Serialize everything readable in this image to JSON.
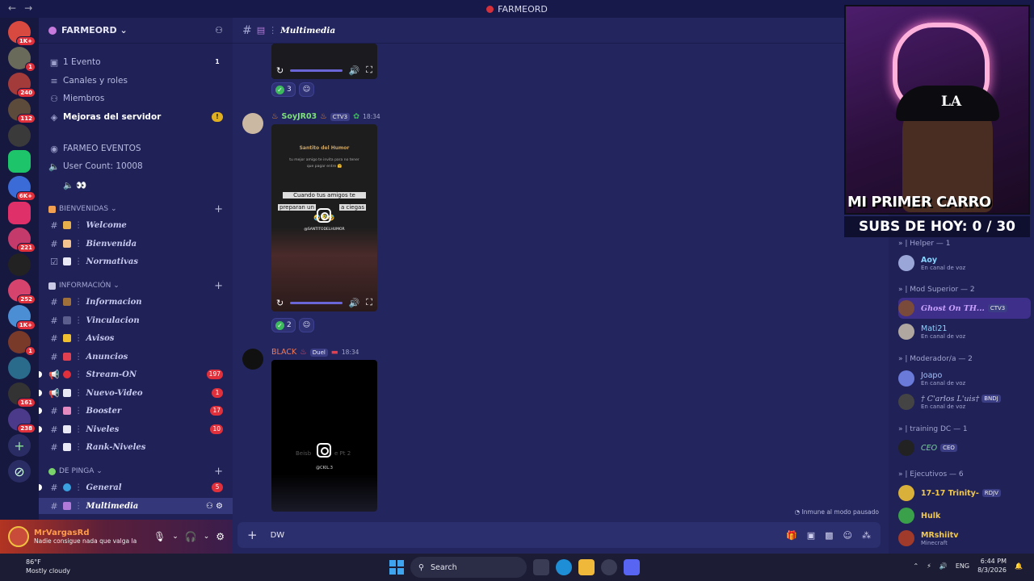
{
  "window": {
    "title": "FARMEORD",
    "back": "←",
    "forward": "→"
  },
  "guilds": {
    "badges": [
      "1K+",
      "1",
      "240",
      "112",
      "6K+",
      "221",
      "252",
      "1K+",
      "1",
      "161",
      "238"
    ]
  },
  "server": {
    "name": "FARMEORD ⌄",
    "items": [
      {
        "label": "1 Evento",
        "count": "1"
      },
      {
        "label": "Canales y roles"
      },
      {
        "label": "Miembros"
      },
      {
        "label": "Mejoras del servidor",
        "count": "!"
      }
    ],
    "info": [
      "FARMEO EVENTOS",
      "User Count: 10008",
      "🔈 👀"
    ]
  },
  "categories": [
    {
      "label": "BIENVENIDAS ⌄",
      "channels": [
        {
          "name": "Welcome"
        },
        {
          "name": "Bienvenida"
        },
        {
          "name": "Normativas"
        }
      ]
    },
    {
      "label": "INFORMACIÓN ⌄",
      "channels": [
        {
          "name": "Informacion"
        },
        {
          "name": "Vinculacion"
        },
        {
          "name": "Avisos"
        },
        {
          "name": "Anuncios"
        },
        {
          "name": "Stream-ON",
          "count": "197"
        },
        {
          "name": "Nuevo-Video",
          "count": "1"
        },
        {
          "name": "Booster",
          "count": "17"
        },
        {
          "name": "Niveles",
          "count": "10"
        },
        {
          "name": "Rank-Niveles"
        }
      ]
    },
    {
      "label": "DE PINGA ⌄",
      "channels": [
        {
          "name": "General",
          "count": "5"
        },
        {
          "name": "Multimedia"
        }
      ]
    }
  ],
  "user": {
    "name": "MrVargasRd",
    "status": "Nadie consigue nada que valga la p..."
  },
  "chat": {
    "channel": "Multimedia",
    "reactions": [
      {
        "count": "3"
      },
      {
        "count": "2"
      }
    ],
    "messages": [
      {
        "author": "SoyJR03",
        "tag": "CTV3",
        "time": "18:34",
        "video_lines": [
          "Santito del Humor",
          "tu mejor amigo te invita para no tener",
          "que pagar entre 🤗",
          "Cuando tus amigos te",
          "preparan un",
          "a ciegas",
          "🤣🤣🤣",
          "@SANTITODELHUMOR"
        ]
      },
      {
        "author": "BLACK",
        "tag": "Duel",
        "time": "18:34",
        "video_lines": [
          "Beisb",
          "e Pt 2",
          "@CKIL.3"
        ]
      }
    ],
    "paused": "Inmune al modo pausado",
    "composer_text": "DW"
  },
  "stream": {
    "overlay": "MI PRIMER CARRO",
    "cap": "LA",
    "subs": "SUBS DE HOY: 0 / 30"
  },
  "members": {
    "groups": [
      {
        "label": "» | Helper — 1",
        "members": [
          {
            "name": "Aoy",
            "sub": "En canal de voz",
            "color": "#8ad4ff"
          }
        ]
      },
      {
        "label": "» | Mod Superior — 2",
        "members": [
          {
            "name": "Ghost On TH...",
            "tag": "CTV3",
            "color": "#c9a2ff"
          },
          {
            "name": "Mati21",
            "sub": "En canal de voz",
            "color": "#8ad4ff"
          }
        ]
      },
      {
        "label": "» | Moderador/a — 2",
        "members": [
          {
            "name": "Joapo",
            "sub": "En canal de voz",
            "color": "#9fc6ff"
          },
          {
            "name": "† C'arlos L'uis†",
            "tag": "BNDJ",
            "sub": "En canal de voz",
            "color": "#b9bbe0"
          }
        ]
      },
      {
        "label": "» | training DC — 1",
        "members": [
          {
            "name": "CEO",
            "tag": "CEO",
            "color": "#7bcf9e"
          }
        ]
      },
      {
        "label": "» | Ejecutivos — 6",
        "members": [
          {
            "name": "17-17 Trinity-",
            "tag": "RDJV",
            "color": "#f2c94c"
          },
          {
            "name": "Hulk",
            "color": "#f2c94c"
          },
          {
            "name": "MRshiitv",
            "sub": "Minecraft",
            "color": "#f2c94c"
          }
        ]
      }
    ]
  },
  "taskbar": {
    "temp": "86°F",
    "weather": "Mostly cloudy",
    "search": "Search",
    "lang": "ENG",
    "time": "6:44 PM",
    "date": "8/3/2026"
  }
}
